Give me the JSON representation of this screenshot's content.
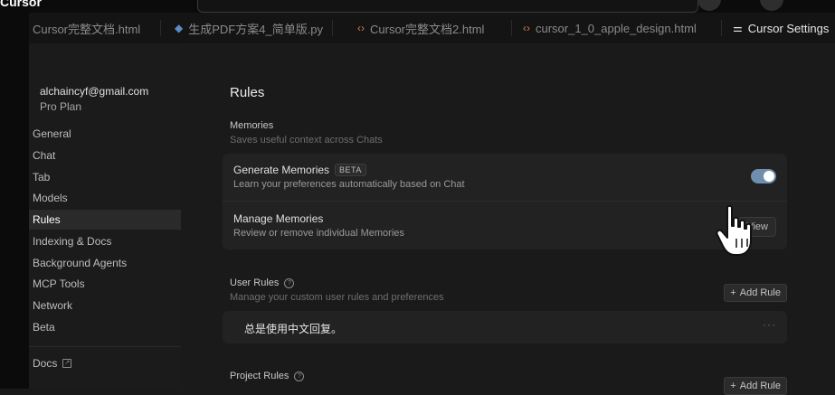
{
  "app": {
    "title": "Cursor"
  },
  "tabs": [
    {
      "label": "Cursor完整文档.html",
      "icon": "html-file-icon"
    },
    {
      "label": "生成PDF方案4_简单版.py",
      "icon": "python-file-icon"
    },
    {
      "label": "Cursor完整文档2.html",
      "icon": "code-file-icon"
    },
    {
      "label": "cursor_1_0_apple_design.html",
      "icon": "code-file-icon"
    },
    {
      "label": "Cursor Settings",
      "icon": "settings-icon"
    }
  ],
  "account": {
    "email": "alchaincyf@gmail.com",
    "plan": "Pro Plan"
  },
  "nav": {
    "items": [
      "General",
      "Chat",
      "Tab",
      "Models",
      "Rules",
      "Indexing & Docs",
      "Background Agents",
      "MCP Tools",
      "Network",
      "Beta"
    ],
    "active": "Rules",
    "docs_label": "Docs"
  },
  "page": {
    "title": "Rules",
    "memories": {
      "title": "Memories",
      "subtitle": "Saves useful context across Chats",
      "generate": {
        "title": "Generate Memories",
        "badge": "BETA",
        "subtitle": "Learn your preferences automatically based on Chat",
        "enabled": true
      },
      "manage": {
        "title": "Manage Memories",
        "subtitle": "Review or remove individual Memories",
        "button": "View"
      }
    },
    "user_rules": {
      "title": "User Rules",
      "subtitle": "Manage your custom user rules and preferences",
      "add_label": "Add Rule",
      "rules": [
        "总是使用中文回复。"
      ],
      "more": "···"
    },
    "project_rules": {
      "title": "Project Rules",
      "add_label": "Add Rule"
    }
  },
  "colors": {
    "accent_toggle": "#6f8fae",
    "background": "#1a1a1a",
    "sidebar": "#1b1b1b"
  }
}
